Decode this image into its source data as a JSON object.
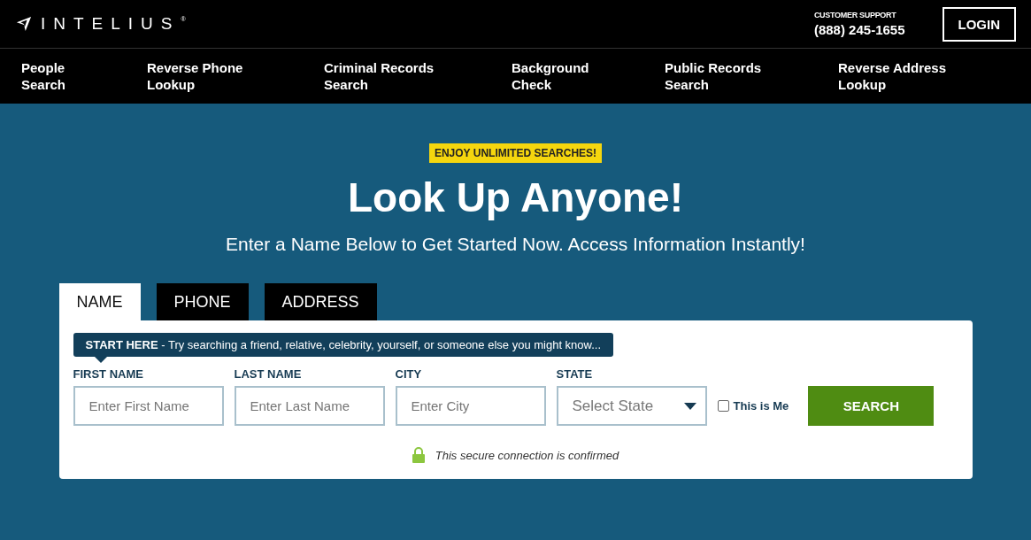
{
  "header": {
    "logo": "INTELIUS",
    "logo_mark": "®",
    "support_label": "CUSTOMER SUPPORT",
    "support_phone": "(888) 245-1655",
    "login": "LOGIN"
  },
  "nav": [
    "People\nSearch",
    "Reverse Phone\nLookup",
    "Criminal Records\nSearch",
    "Background\nCheck",
    "Public Records\nSearch",
    "Reverse Address\nLookup"
  ],
  "hero": {
    "badge": "ENJOY UNLIMITED SEARCHES!",
    "title": "Look Up Anyone!",
    "subtitle": "Enter a Name Below to Get Started Now. Access Information Instantly!"
  },
  "tabs": [
    {
      "label": "NAME",
      "selected": true
    },
    {
      "label": "PHONE",
      "selected": false
    },
    {
      "label": "ADDRESS",
      "selected": false
    }
  ],
  "form": {
    "tip": "**START HERE** - Try searching a friend, relative, celebrity, yourself, or someone else you might know...",
    "fields": [
      {
        "kind": "text",
        "label": "FIRST NAME",
        "placeholder": "Enter First Name"
      },
      {
        "kind": "text",
        "label": "LAST NAME",
        "placeholder": "Enter Last Name"
      },
      {
        "kind": "text",
        "label": "CITY",
        "placeholder": "Enter City"
      },
      {
        "kind": "select",
        "label": "STATE",
        "placeholder": "Select State"
      }
    ],
    "this_is_me": {
      "label": "This is Me",
      "checked": false
    },
    "search": "SEARCH",
    "secure_note": "This secure connection is confirmed"
  }
}
